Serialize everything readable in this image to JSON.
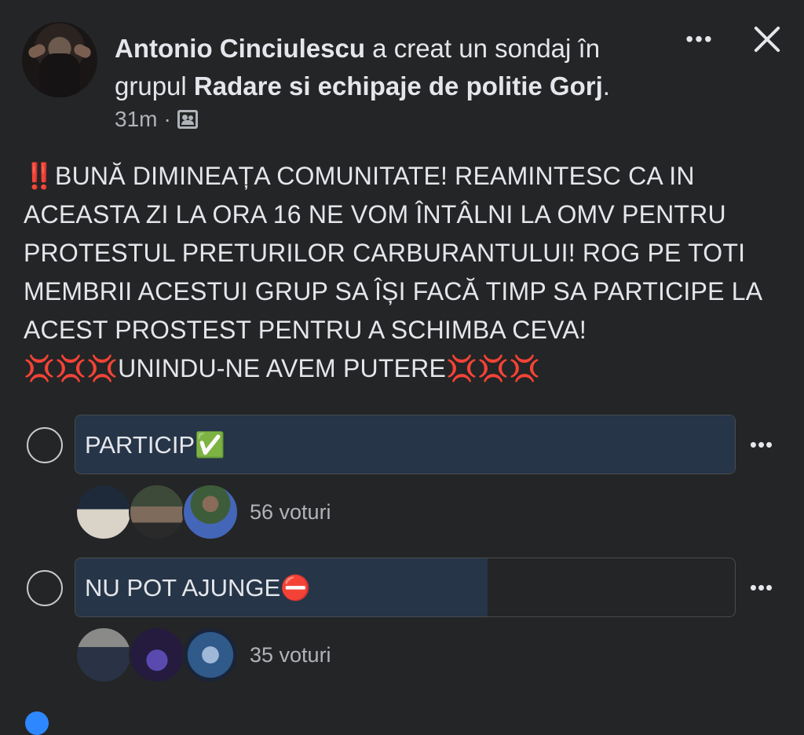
{
  "header": {
    "author": "Antonio Cinciulescu",
    "action": " a creat un sondaj în grupul ",
    "group": "Radare si echipaje de politie Gorj",
    "period": ".",
    "time": "31m",
    "separator": "·",
    "more_label": "•••",
    "icons": {
      "privacy": "group-icon",
      "close": "close-icon",
      "more": "more-icon"
    }
  },
  "post": {
    "text": "‼️BUNĂ DIMINEAȚA COMUNITATE! REAMINTESC CA IN ACEASTA ZI LA ORA 16 NE VOM ÎNTÂLNI LA OMV PENTRU PROTESTUL PRETURILOR CARBURANTULUI! ROG PE TOTI MEMBRII ACESTUI GRUP SA ÎȘI FACĂ TIMP SA PARTICIPE LA ACEST PROSTEST PENTRU A SCHIMBA CEVA! 💢💢💢UNINDU-NE AVEM PUTERE💢💢💢"
  },
  "poll": {
    "options": [
      {
        "label": "PARTICIP✅",
        "votes_text": "56 voturi",
        "fill_fraction": 1.0,
        "more_label": "•••"
      },
      {
        "label": "NU POT AJUNGE⛔️",
        "votes_text": "35 voturi",
        "fill_fraction": 0.625,
        "more_label": "•••"
      }
    ]
  },
  "colors": {
    "background": "#242526",
    "bar_fill": "#263548",
    "text": "#e4e6eb",
    "secondary": "#b0b3b8"
  }
}
